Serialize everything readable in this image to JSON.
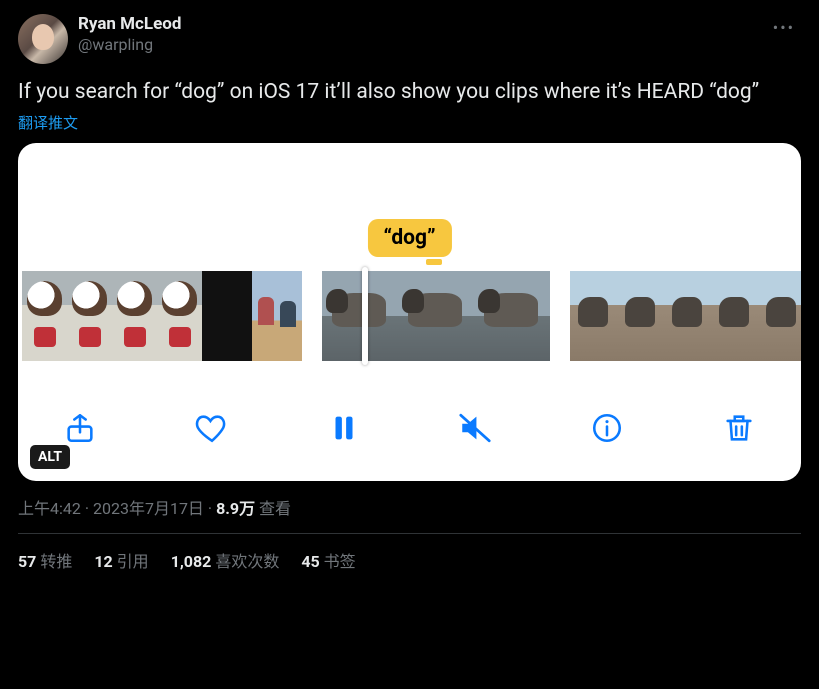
{
  "user": {
    "display_name": "Ryan McLeod",
    "handle": "@warpling"
  },
  "tweet_text": "If you search for “dog” on iOS 17 it’ll also show you clips where it’s HEARD “dog”",
  "translate_label": "翻译推文",
  "media": {
    "caption": "“dog”",
    "alt_badge": "ALT"
  },
  "meta": {
    "time": "上午4:42",
    "sep": " · ",
    "date": "2023年7月17日",
    "views_count": "8.9万",
    "views_label": " 查看"
  },
  "stats": {
    "retweets": {
      "count": "57",
      "label": " 转推"
    },
    "quotes": {
      "count": "12",
      "label": " 引用"
    },
    "likes": {
      "count": "1,082",
      "label": " 喜欢次数"
    },
    "bookmarks": {
      "count": "45",
      "label": " 书签"
    }
  }
}
